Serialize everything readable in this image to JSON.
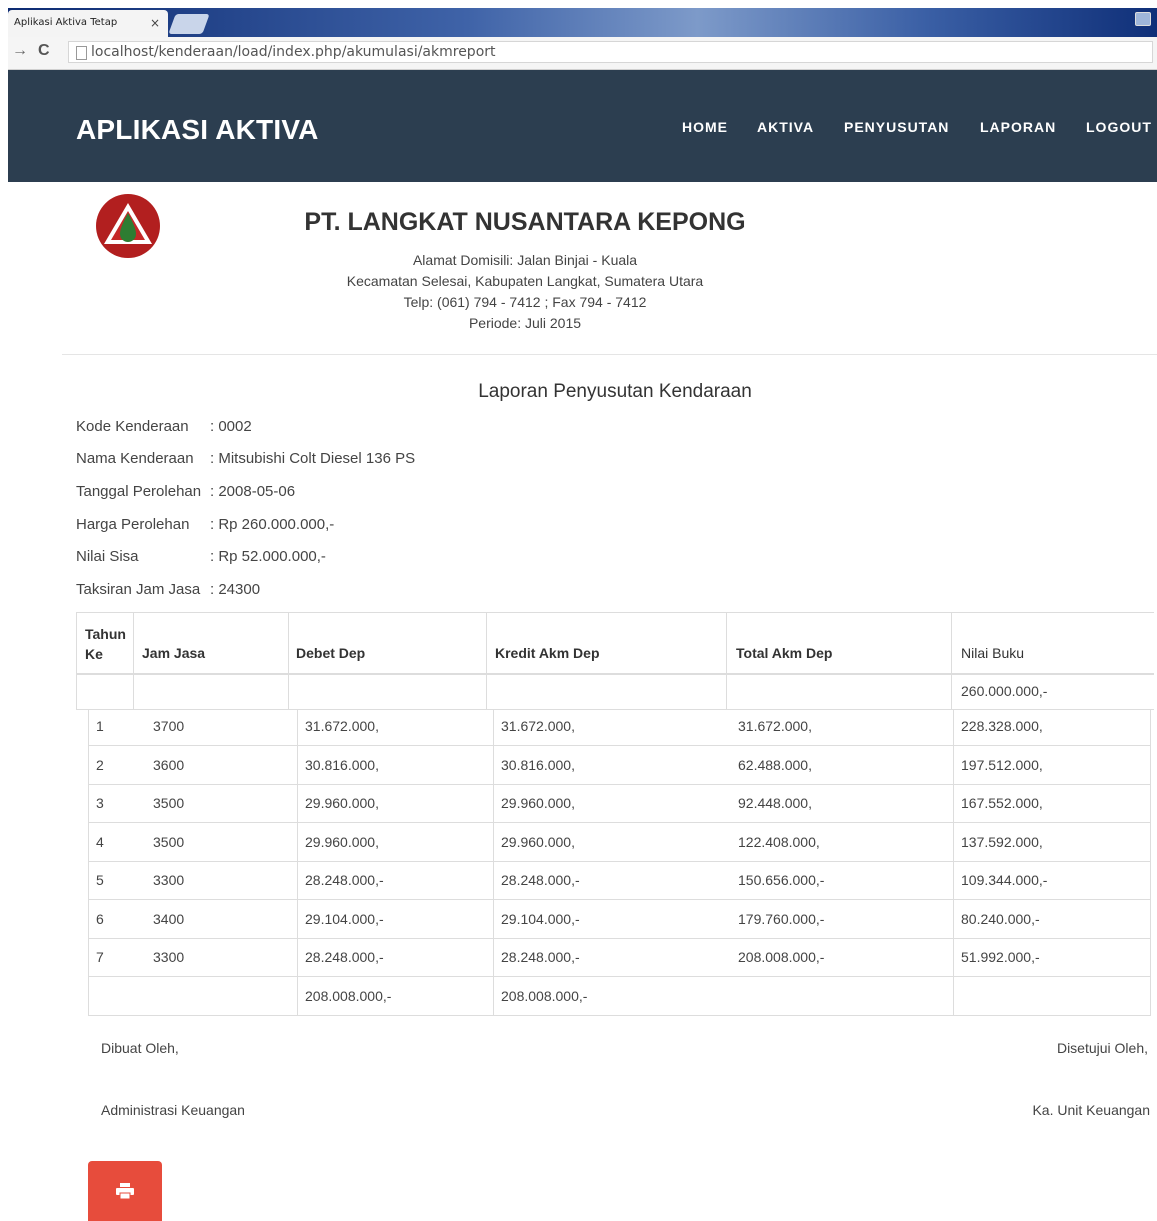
{
  "browser": {
    "tab_title": "Aplikasi Aktiva Tetap",
    "tab_close": "×",
    "url": "localhost/kenderaan/load/index.php/akumulasi/akmreport"
  },
  "navbar": {
    "brand": "APLIKASI AKTIVA",
    "menu": [
      "HOME",
      "AKTIVA",
      "PENYUSUTAN",
      "LAPORAN",
      "LOGOUT"
    ]
  },
  "company": {
    "name": "PT. LANGKAT NUSANTARA KEPONG",
    "address_lines": [
      "Alamat Domisili: Jalan Binjai - Kuala",
      "Kecamatan Selesai, Kabupaten Langkat, Sumatera Utara",
      "Telp: (061) 794 - 7412 ; Fax 794 - 7412",
      "Periode: Juli 2015"
    ]
  },
  "report": {
    "title": "Laporan Penyusutan Kendaraan",
    "info": [
      {
        "label": "Kode Kenderaan",
        "value": ": 0002"
      },
      {
        "label": "Nama Kenderaan",
        "value": ": Mitsubishi Colt Diesel 136 PS"
      },
      {
        "label": "Tanggal Perolehan",
        "value": ": 2008-05-06"
      },
      {
        "label": "Harga Perolehan",
        "value": ": Rp 260.000.000,-"
      },
      {
        "label": "Nilai Sisa",
        "value": ": Rp 52.000.000,-"
      },
      {
        "label": "Taksiran Jam Jasa",
        "value": ": 24300"
      }
    ]
  },
  "table": {
    "headers": [
      "Tahun Ke",
      "Jam Jasa",
      "Debet Dep",
      "Kredit Akm Dep",
      "Total Akm Dep",
      "Nilai Buku"
    ],
    "initial_nilai_buku": "260.000.000,-",
    "rows": [
      [
        "1",
        "3700",
        "31.672.000,",
        "31.672.000,",
        "31.672.000,",
        "228.328.000,"
      ],
      [
        "2",
        "3600",
        "30.816.000,",
        "30.816.000,",
        "62.488.000,",
        "197.512.000,"
      ],
      [
        "3",
        "3500",
        "29.960.000,",
        "29.960.000,",
        "92.448.000,",
        "167.552.000,"
      ],
      [
        "4",
        "3500",
        "29.960.000,",
        "29.960.000,",
        "122.408.000,",
        "137.592.000,"
      ],
      [
        "5",
        "3300",
        "28.248.000,-",
        "28.248.000,-",
        "150.656.000,-",
        "109.344.000,-"
      ],
      [
        "6",
        "3400",
        "29.104.000,-",
        "29.104.000,-",
        "179.760.000,-",
        "80.240.000,-"
      ],
      [
        "7",
        "3300",
        "28.248.000,-",
        "28.248.000,-",
        "208.008.000,-",
        "51.992.000,-"
      ]
    ],
    "totals": {
      "debet": "208.008.000,-",
      "kredit": "208.008.000,-"
    }
  },
  "signatures": {
    "left_title": "Dibuat Oleh,",
    "left_role": "Administrasi Keuangan",
    "right_title": "Disetujui Oleh,",
    "right_role": "Ka. Unit Keuangan"
  },
  "icons": {
    "print": "print-icon",
    "reload": "reload-icon",
    "forward": "forward-icon"
  },
  "colors": {
    "navbar": "#2c3e50",
    "print_button": "#e74c3c",
    "logo": "#b21f1f"
  }
}
